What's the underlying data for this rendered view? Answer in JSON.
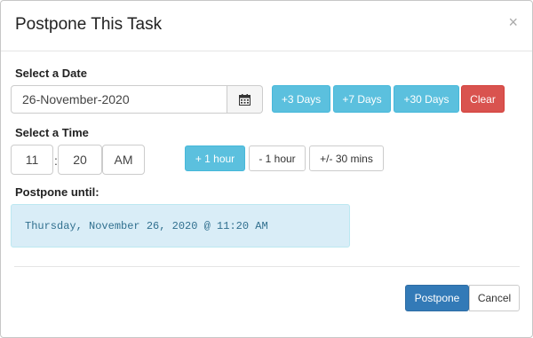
{
  "dialog": {
    "title": "Postpone This Task",
    "close_glyph": "×"
  },
  "date_section": {
    "label": "Select a Date",
    "date_value": "26-November-2020",
    "calendar_icon": "calendar-icon",
    "quick_buttons": {
      "plus3": "+3 Days",
      "plus7": "+7 Days",
      "plus30": "+30 Days",
      "clear": "Clear"
    }
  },
  "time_section": {
    "label": "Select a Time",
    "hour": "11",
    "separator": ":",
    "minute": "20",
    "ampm": "AM",
    "buttons": {
      "plus_hour": "+ 1 hour",
      "minus_hour": "- 1 hour",
      "half_hour": "+/- 30 mins"
    }
  },
  "postpone_until": {
    "label": "Postpone until:",
    "value": "Thursday, November 26, 2020 @ 11:20 AM"
  },
  "footer": {
    "postpone_label": "Postpone",
    "cancel_label": "Cancel"
  },
  "colors": {
    "info": "#5bc0de",
    "danger": "#d9534f",
    "primary": "#337ab7",
    "alert_bg": "#d9edf7",
    "alert_text": "#31708f"
  }
}
